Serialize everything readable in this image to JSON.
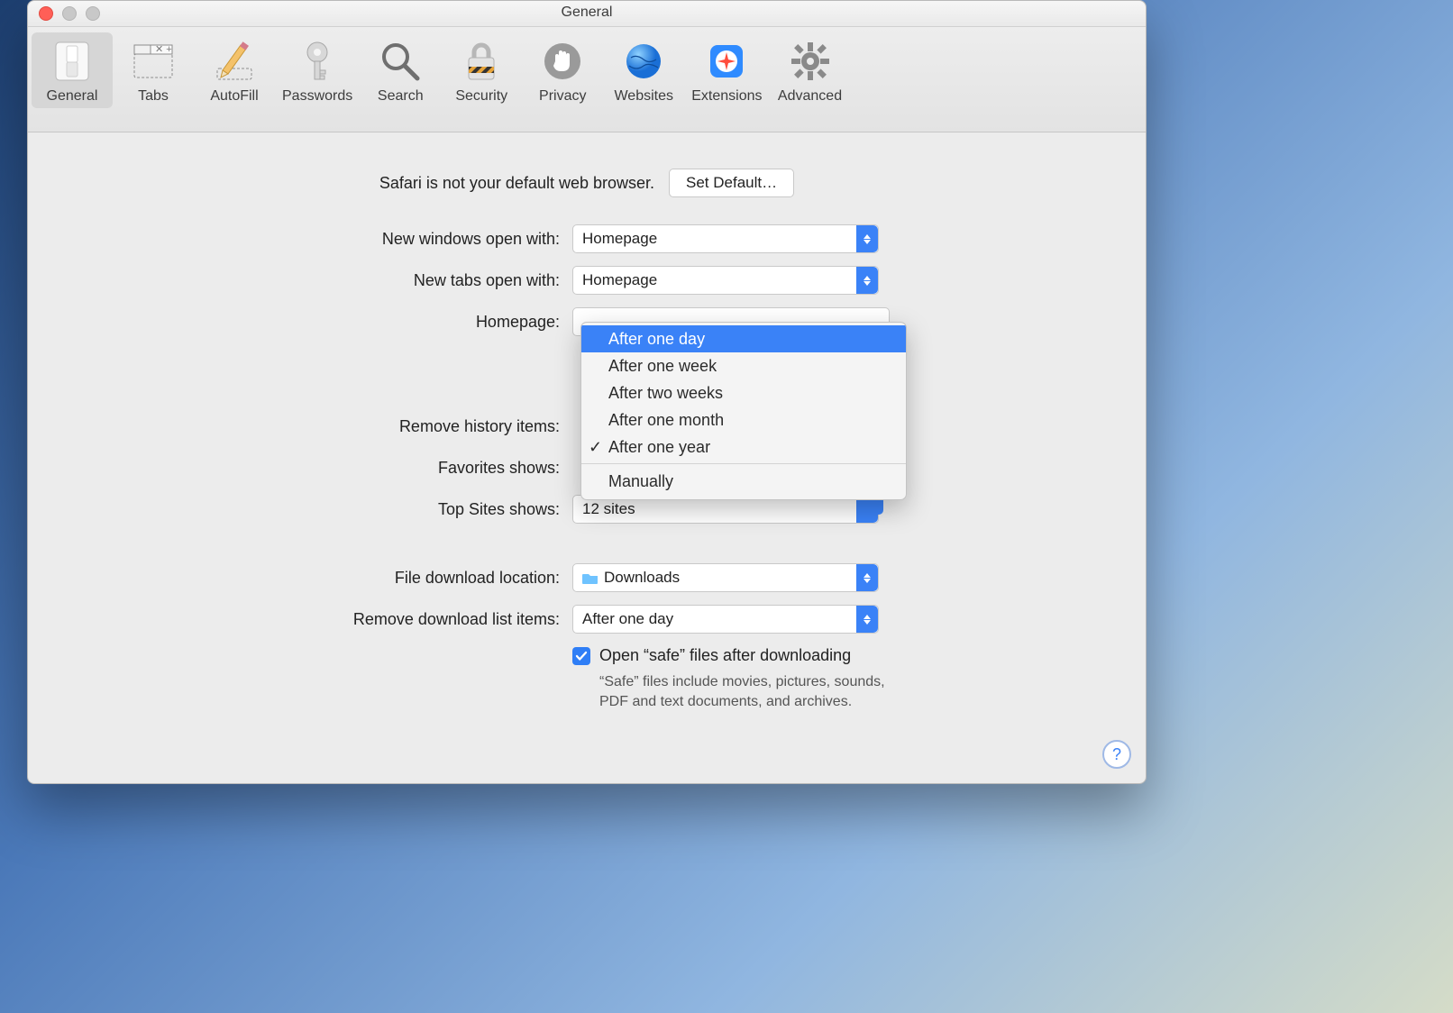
{
  "window": {
    "title": "General"
  },
  "toolbar": {
    "items": [
      {
        "id": "general",
        "label": "General"
      },
      {
        "id": "tabs",
        "label": "Tabs"
      },
      {
        "id": "autofill",
        "label": "AutoFill"
      },
      {
        "id": "passwords",
        "label": "Passwords"
      },
      {
        "id": "search",
        "label": "Search"
      },
      {
        "id": "security",
        "label": "Security"
      },
      {
        "id": "privacy",
        "label": "Privacy"
      },
      {
        "id": "websites",
        "label": "Websites"
      },
      {
        "id": "extensions",
        "label": "Extensions"
      },
      {
        "id": "advanced",
        "label": "Advanced"
      }
    ],
    "selected": "general"
  },
  "default_browser": {
    "message": "Safari is not your default web browser.",
    "button": "Set Default…"
  },
  "rows": {
    "new_windows": {
      "label": "New windows open with:",
      "value": "Homepage"
    },
    "new_tabs": {
      "label": "New tabs open with:",
      "value": "Homepage"
    },
    "homepage": {
      "label": "Homepage:"
    },
    "remove_history": {
      "label": "Remove history items:"
    },
    "favorites": {
      "label": "Favorites shows:"
    },
    "top_sites": {
      "label": "Top Sites shows:",
      "value": "12 sites"
    },
    "download_loc": {
      "label": "File download location:",
      "value": "Downloads"
    },
    "remove_downloads": {
      "label": "Remove download list items:",
      "value": "After one day"
    }
  },
  "history_menu": {
    "highlighted": "After one day",
    "checked": "After one year",
    "items": [
      "After one day",
      "After one week",
      "After two weeks",
      "After one month",
      "After one year"
    ],
    "extra": "Manually"
  },
  "safe_files": {
    "checkbox_label": "Open “safe” files after downloading",
    "description": "“Safe” files include movies, pictures, sounds, PDF and text documents, and archives."
  },
  "help_tooltip": "?"
}
